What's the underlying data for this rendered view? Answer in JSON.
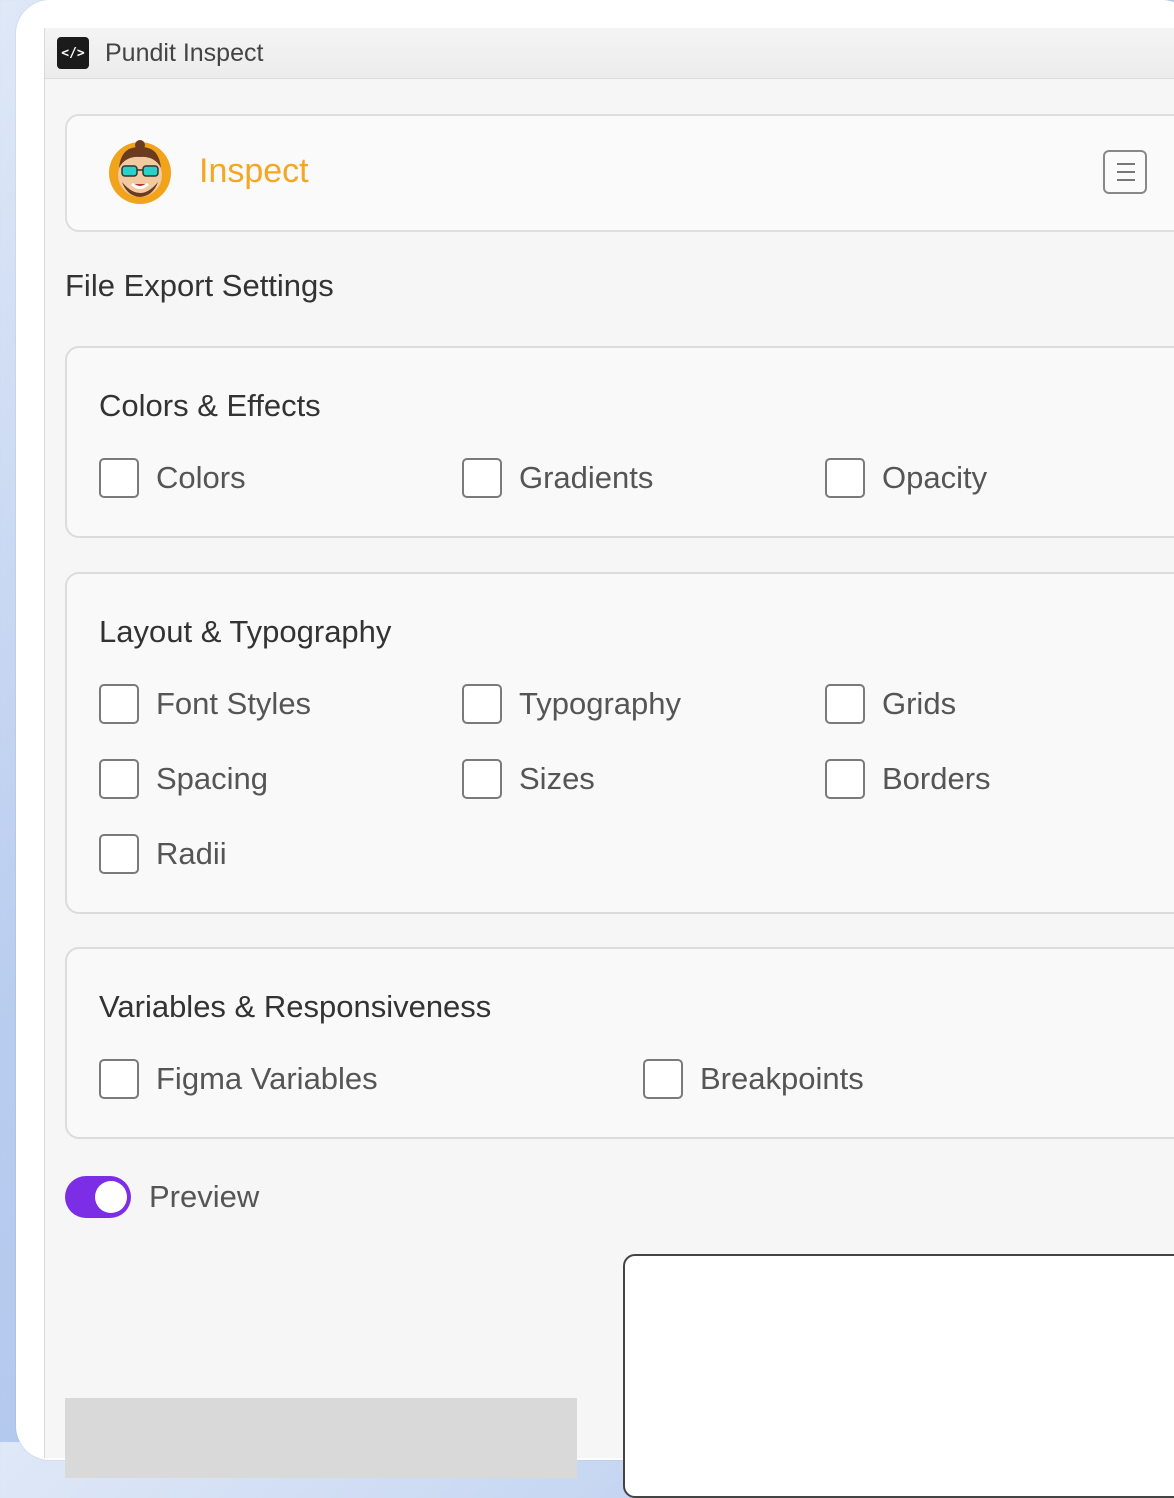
{
  "window": {
    "title": "Pundit Inspect",
    "app_icon_glyph": "</>"
  },
  "header": {
    "title": "Inspect",
    "title_color": "#f5a623",
    "menu_icon": "menu-list-icon"
  },
  "page_heading": "File Export Settings",
  "sections": {
    "colors_effects": {
      "title": "Colors & Effects",
      "options": [
        "Colors",
        "Gradients",
        "Opacity"
      ]
    },
    "layout_typography": {
      "title": "Layout & Typography",
      "options": [
        "Font Styles",
        "Typography",
        "Grids",
        "Spacing",
        "Sizes",
        "Borders",
        "Radii"
      ]
    },
    "variables_responsiveness": {
      "title": "Variables & Responsiveness",
      "options": [
        "Figma Variables",
        "Breakpoints"
      ]
    }
  },
  "preview": {
    "label": "Preview",
    "enabled": true,
    "toggle_color": "#7c2ee6"
  }
}
